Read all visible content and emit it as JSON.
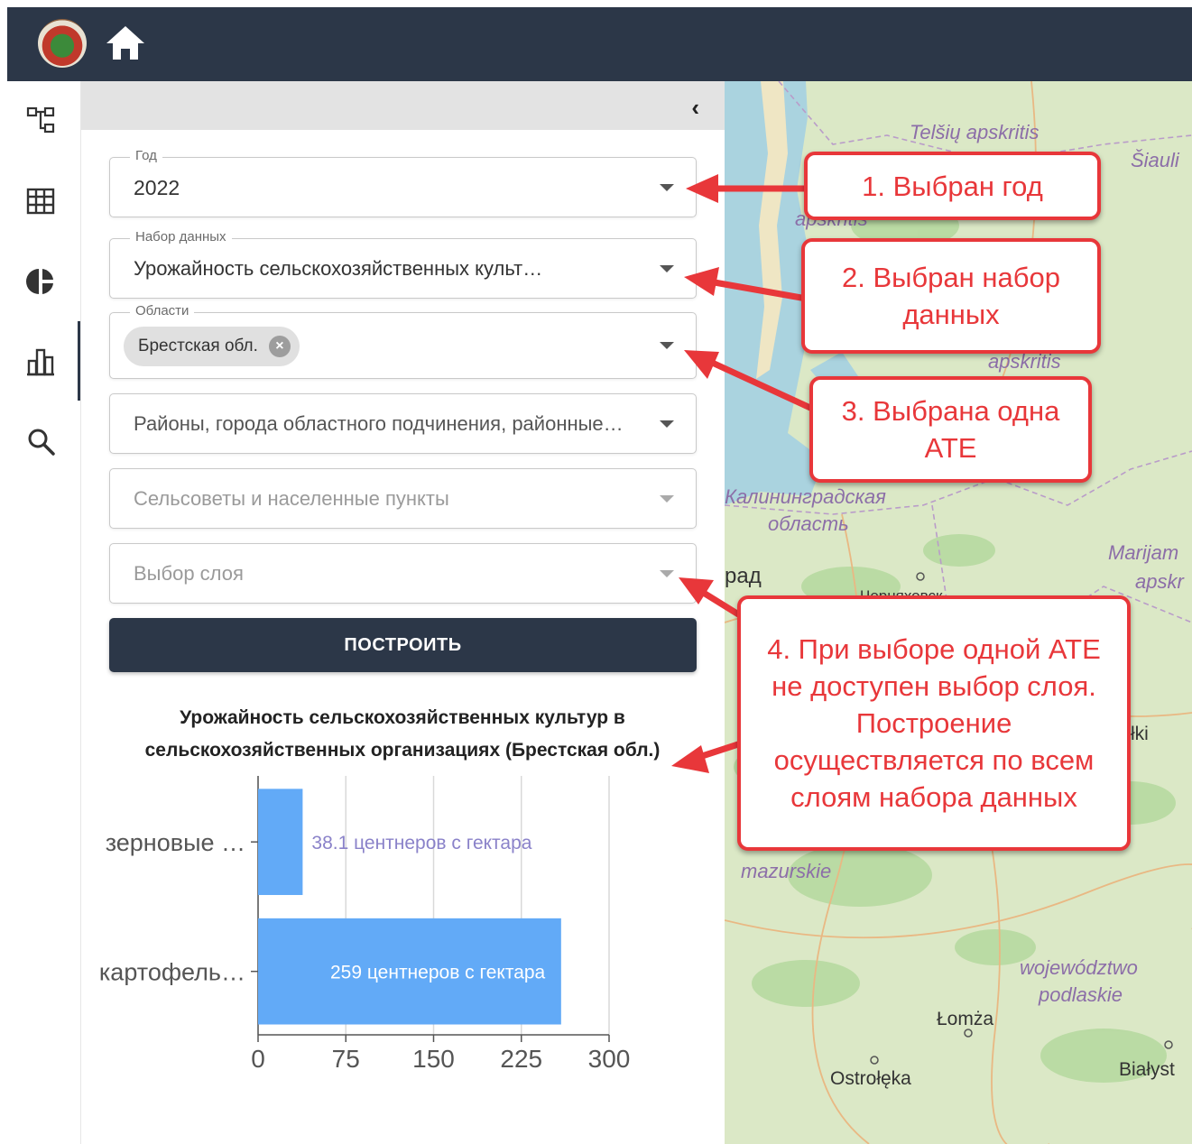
{
  "header": {
    "logo_icon": "emblem-logo-icon",
    "home_icon": "home-icon"
  },
  "sidebar": {
    "items": [
      {
        "icon": "hierarchy-icon"
      },
      {
        "icon": "table-grid-icon"
      },
      {
        "icon": "pie-chart-icon"
      },
      {
        "icon": "bar-chart-icon",
        "active": true
      },
      {
        "icon": "search-icon"
      }
    ]
  },
  "panel": {
    "collapse_glyph": "‹",
    "year": {
      "label": "Год",
      "value": "2022"
    },
    "dataset": {
      "label": "Набор данных",
      "value": "Урожайность сельскохозяйственных культ…"
    },
    "regions": {
      "label": "Области",
      "chip": "Брестская обл."
    },
    "districts": {
      "placeholder": "Районы, города областного подчинения, районные…"
    },
    "councils": {
      "placeholder": "Сельсоветы и населенные пункты"
    },
    "layer": {
      "placeholder": "Выбор слоя"
    },
    "build_button": "ПОСТРОИТЬ"
  },
  "chart_data": {
    "type": "bar",
    "orientation": "horizontal",
    "title_line1": "Урожайность сельскохозяйственных культур в",
    "title_line2": "сельскохозяйственных организациях (Брестская обл.)",
    "categories": [
      "зерновые …",
      "картофель…"
    ],
    "values": [
      38.1,
      259
    ],
    "data_labels": [
      "38.1 центнеров с гектара",
      "259 центнеров с гектара"
    ],
    "xlim": [
      0,
      300
    ],
    "xticks": [
      "0",
      "75",
      "150",
      "225",
      "300"
    ],
    "grid": true,
    "bar_color": "#62aaf7"
  },
  "map": {
    "labels": [
      "Telšių apskritis",
      "Šiauli",
      "apskritis",
      "apskritis",
      "Калининградская",
      "область",
      "Marijam",
      "apskr",
      "рад",
      "Черняховск",
      "łki",
      "mazurskie",
      "województwo",
      "podlaskie",
      "Łomża",
      "Ostrołęka",
      "Białyst"
    ]
  },
  "annotations": [
    "1. Выбран год",
    "2. Выбран набор данных",
    "3. Выбрана одна АТЕ",
    "4. При выборе одной АТЕ не доступен выбор слоя. Построение осуществляется по всем слоям набора данных"
  ],
  "colors": {
    "header": "#2c3748",
    "accent_red": "#e8373a",
    "bar": "#62aaf7"
  }
}
